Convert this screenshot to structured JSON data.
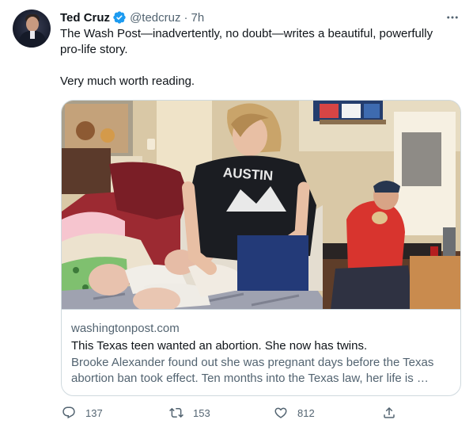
{
  "tweet": {
    "author_name": "Ted Cruz",
    "author_handle": "@tedcruz",
    "separator": "·",
    "timestamp": "7h",
    "text_line_1": "The Wash Post—inadvertently, no doubt—writes a beautiful, powerfully",
    "text_line_2": "pro-life story.",
    "text_line_3": "Very much worth reading."
  },
  "card": {
    "domain": "washingtonpost.com",
    "title": "This Texas teen wanted an abortion. She now has twins.",
    "description_line_1": "Brooke Alexander found out she was pregnant days before the Texas",
    "description_line_2": "abortion ban took effect. Ten months into the Texas law, her life is …",
    "shirt_text": "AUSTIN"
  },
  "actions": {
    "replies": "137",
    "retweets": "153",
    "likes": "812"
  },
  "colors": {
    "text_primary": "#0f1419",
    "text_secondary": "#536471",
    "verified_blue": "#1d9bf0",
    "border": "#cfd9de"
  },
  "icons": [
    "verified-badge-icon",
    "more-options-icon",
    "reply-icon",
    "retweet-icon",
    "like-icon",
    "share-icon"
  ]
}
